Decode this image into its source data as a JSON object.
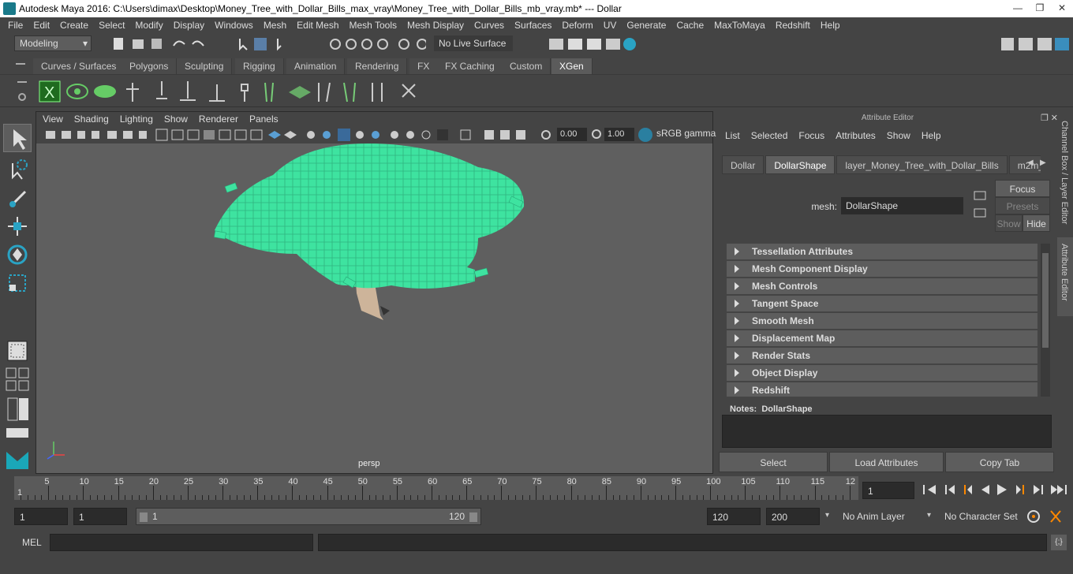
{
  "window": {
    "title": "Autodesk Maya 2016: C:\\Users\\dimax\\Desktop\\Money_Tree_with_Dollar_Bills_max_vray\\Money_Tree_with_Dollar_Bills_mb_vray.mb*   ---   Dollar"
  },
  "menubar": [
    "File",
    "Edit",
    "Create",
    "Select",
    "Modify",
    "Display",
    "Windows",
    "Mesh",
    "Edit Mesh",
    "Mesh Tools",
    "Mesh Display",
    "Curves",
    "Surfaces",
    "Deform",
    "UV",
    "Generate",
    "Cache",
    "MaxToMaya",
    "Redshift",
    "Help"
  ],
  "status": {
    "mode": "Modeling",
    "live_surface": "No Live Surface"
  },
  "shelf_tabs": [
    {
      "label": "Curves / Surfaces",
      "active": false
    },
    {
      "label": "Polygons",
      "active": false
    },
    {
      "label": "Sculpting",
      "active": false
    },
    {
      "label": "Rigging",
      "active": false
    },
    {
      "label": "Animation",
      "active": false
    },
    {
      "label": "Rendering",
      "active": false
    },
    {
      "label": "FX",
      "active": false
    },
    {
      "label": "FX Caching",
      "active": false
    },
    {
      "label": "Custom",
      "active": false
    },
    {
      "label": "XGen",
      "active": true
    }
  ],
  "viewport": {
    "menu": [
      "View",
      "Shading",
      "Lighting",
      "Show",
      "Renderer",
      "Panels"
    ],
    "exposure": "0.00",
    "gamma": "1.00",
    "color_space": "sRGB gamma",
    "camera_label": "persp"
  },
  "attribute_editor": {
    "title": "Attribute Editor",
    "menu": [
      "List",
      "Selected",
      "Focus",
      "Attributes",
      "Show",
      "Help"
    ],
    "tabs": [
      {
        "label": "Dollar",
        "active": false
      },
      {
        "label": "DollarShape",
        "active": true
      },
      {
        "label": "layer_Money_Tree_with_Dollar_Bills",
        "active": false
      },
      {
        "label": "m2m_",
        "active": false
      }
    ],
    "mesh_label": "mesh:",
    "mesh_value": "DollarShape",
    "focus_btn": "Focus",
    "presets_btn": "Presets",
    "show_btn": "Show",
    "hide_btn": "Hide",
    "sections": [
      "Tessellation Attributes",
      "Mesh Component Display",
      "Mesh Controls",
      "Tangent Space",
      "Smooth Mesh",
      "Displacement Map",
      "Render Stats",
      "Object Display",
      "Redshift"
    ],
    "notes_label": "Notes:",
    "notes_value": "DollarShape",
    "buttons": {
      "select": "Select",
      "load": "Load Attributes",
      "copy": "Copy Tab"
    }
  },
  "side_tabs": {
    "channel_box": "Channel Box / Layer Editor",
    "attribute_editor": "Attribute Editor"
  },
  "timeline": {
    "ticks": [
      "5",
      "10",
      "15",
      "20",
      "25",
      "30",
      "35",
      "40",
      "45",
      "50",
      "55",
      "60",
      "65",
      "70",
      "75",
      "80",
      "85",
      "90",
      "95",
      "100",
      "105",
      "110",
      "115",
      "12"
    ],
    "start_marker": "1",
    "current_frame": "1"
  },
  "range": {
    "start": "1",
    "playback_start": "1",
    "slider_start": "1",
    "slider_end": "120",
    "playback_end": "120",
    "end": "200",
    "anim_layer": "No Anim Layer",
    "char_set": "No Character Set"
  },
  "cmd": {
    "label": "MEL"
  }
}
